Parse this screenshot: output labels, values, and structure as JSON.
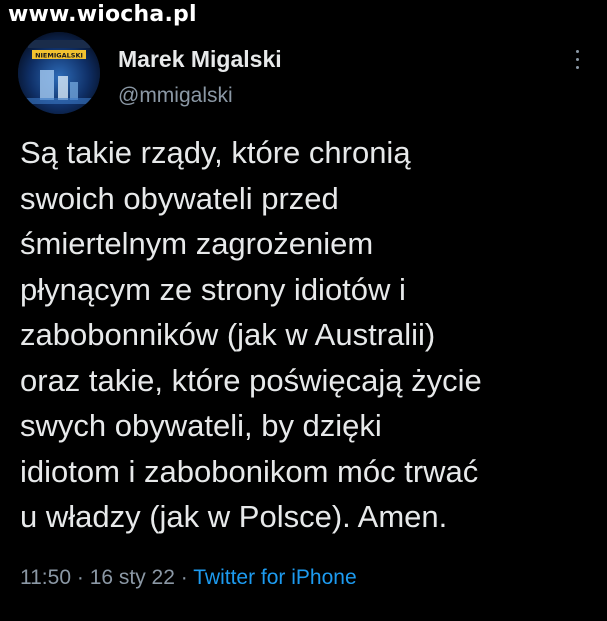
{
  "watermark": "www.wiocha.pl",
  "tweet": {
    "author": {
      "name": "Marek Migalski",
      "handle": "@mmigalski",
      "avatar_book_title": "NIEMIGALSKI"
    },
    "text_lines": [
      "Są takie rządy, które chronią",
      "swoich obywateli przed",
      "śmiertelnym zagrożeniem",
      "płynącym ze strony idiotów i",
      "zabobonników (jak w Australii)",
      "oraz takie, które poświęcają życie",
      "swych obywateli, by dzięki",
      "idiotom i zabobonikom móc trwać",
      "u władzy (jak w Polsce). Amen."
    ],
    "time": "11:50",
    "separator": "·",
    "date": "16 sty 22",
    "source": "Twitter for iPhone"
  },
  "colors": {
    "background": "#000000",
    "text": "#e7e9ea",
    "secondary": "#8b98a5",
    "link": "#1d9bf0"
  },
  "icons": {
    "more": "more-vertical-icon"
  }
}
